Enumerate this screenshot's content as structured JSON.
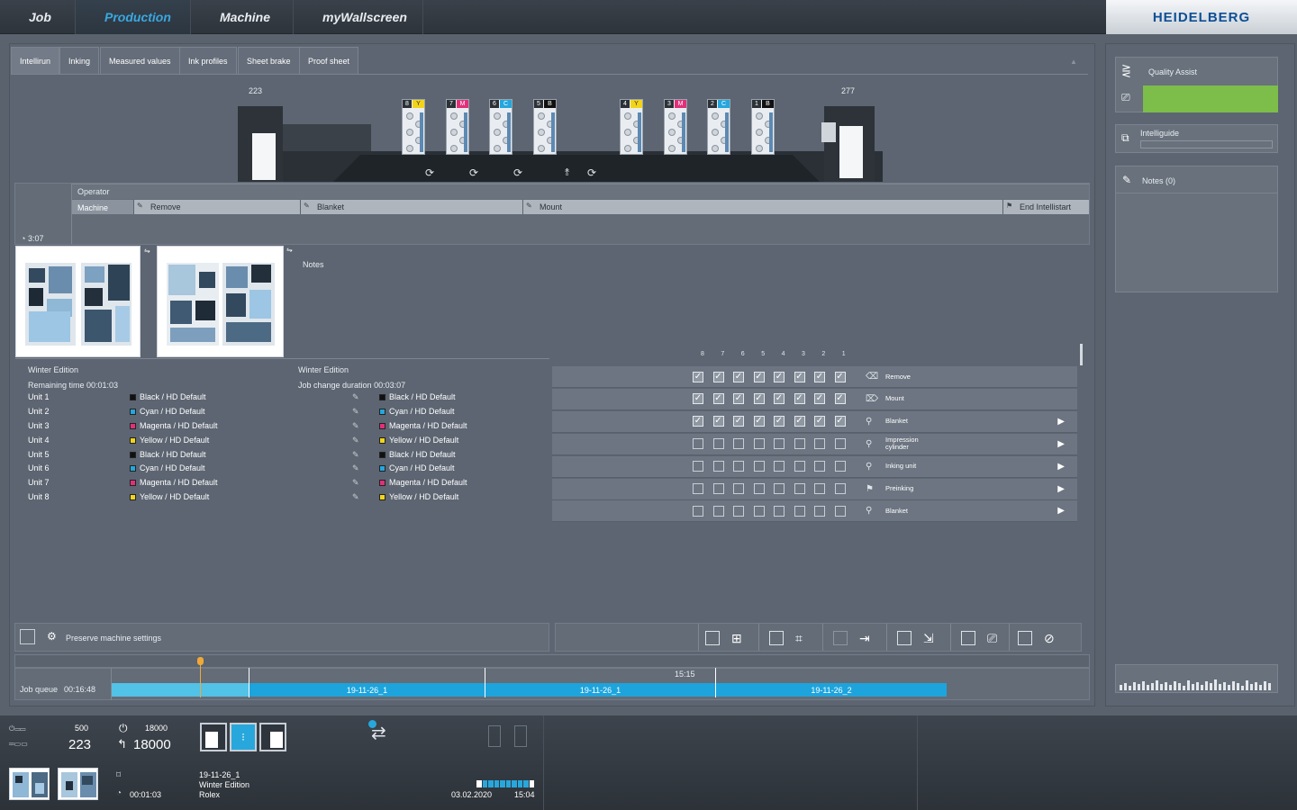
{
  "nav": {
    "tabs": [
      "Job",
      "Production",
      "Machine",
      "myWallscreen"
    ],
    "brand": "HEIDELBERG"
  },
  "subtabs": [
    "Intellirun",
    "Inking",
    "Measured values",
    "Ink profiles",
    "Sheet brake",
    "Proof sheet"
  ],
  "machine": {
    "left_count": "223",
    "right_count": "277",
    "units": [
      {
        "num": "8",
        "color": "Y",
        "hex": "#f2d41a"
      },
      {
        "num": "7",
        "color": "M",
        "hex": "#e0307a"
      },
      {
        "num": "6",
        "color": "C",
        "hex": "#25a6dc"
      },
      {
        "num": "5",
        "color": "B",
        "hex": "#111111"
      },
      {
        "num": "4",
        "color": "Y",
        "hex": "#f2d41a"
      },
      {
        "num": "3",
        "color": "M",
        "hex": "#e0307a"
      },
      {
        "num": "2",
        "color": "C",
        "hex": "#25a6dc"
      },
      {
        "num": "1",
        "color": "B",
        "hex": "#111111"
      }
    ]
  },
  "timeline": {
    "operator": "Operator",
    "machine": "Machine",
    "time": "3:07",
    "steps": [
      "Remove",
      "Blanket",
      "Mount",
      "End Intellistart"
    ]
  },
  "notes_label": "Notes",
  "job_left": {
    "title": "Winter Edition",
    "sub": "Remaining time 00:01:03"
  },
  "job_right": {
    "title": "Winter Edition",
    "sub": "Job change duration 00:03:07"
  },
  "units": [
    {
      "unit": "Unit 1",
      "ink": "Black / HD Default",
      "hex": "#111111",
      "ink2": "Black / HD Default"
    },
    {
      "unit": "Unit 2",
      "ink": "Cyan / HD Default",
      "hex": "#25a6dc",
      "ink2": "Cyan / HD Default"
    },
    {
      "unit": "Unit 3",
      "ink": "Magenta / HD Default",
      "hex": "#e0307a",
      "ink2": "Magenta / HD Default"
    },
    {
      "unit": "Unit 4",
      "ink": "Yellow / HD Default",
      "hex": "#f2d41a",
      "ink2": "Yellow / HD Default"
    },
    {
      "unit": "Unit 5",
      "ink": "Black / HD Default",
      "hex": "#111111",
      "ink2": "Black / HD Default"
    },
    {
      "unit": "Unit 6",
      "ink": "Cyan / HD Default",
      "hex": "#25a6dc",
      "ink2": "Cyan / HD Default"
    },
    {
      "unit": "Unit 7",
      "ink": "Magenta / HD Default",
      "hex": "#e0307a",
      "ink2": "Magenta / HD Default"
    },
    {
      "unit": "Unit 8",
      "ink": "Yellow / HD Default",
      "hex": "#f2d41a",
      "ink2": "Yellow / HD Default"
    }
  ],
  "process": {
    "columns": [
      "8",
      "7",
      "6",
      "5",
      "4",
      "3",
      "2",
      "1"
    ],
    "rows": [
      {
        "label": "Remove",
        "checked": true,
        "arrow": false
      },
      {
        "label": "Mount",
        "checked": true,
        "arrow": false
      },
      {
        "label": "Blanket",
        "checked": true,
        "arrow": true
      },
      {
        "label": "Impression cylinder",
        "checked": false,
        "arrow": true
      },
      {
        "label": "Inking unit",
        "checked": false,
        "arrow": true
      },
      {
        "label": "Preinking",
        "checked": false,
        "arrow": true
      },
      {
        "label": "Blanket",
        "checked": false,
        "arrow": true
      }
    ]
  },
  "preserve_label": "Preserve machine settings",
  "queue": {
    "label": "Job queue",
    "duration": "00:16:48",
    "marker_time": "15:15",
    "jobs": [
      "19-11-26_1",
      "19-11-26_1",
      "19-11-26_2"
    ]
  },
  "side": {
    "quality": "Quality Assist",
    "intelliguide": "Intelliguide",
    "notes": "Notes (0)"
  },
  "bottom": {
    "small_top": "500",
    "big_left": "223",
    "small_top2": "18000",
    "big_right": "18000",
    "remaining": "00:01:03",
    "job_id": "19-11-26_1",
    "job_name": "Winter Edition",
    "customer": "Rolex",
    "date": "03.02.2020",
    "time": "15:04"
  }
}
